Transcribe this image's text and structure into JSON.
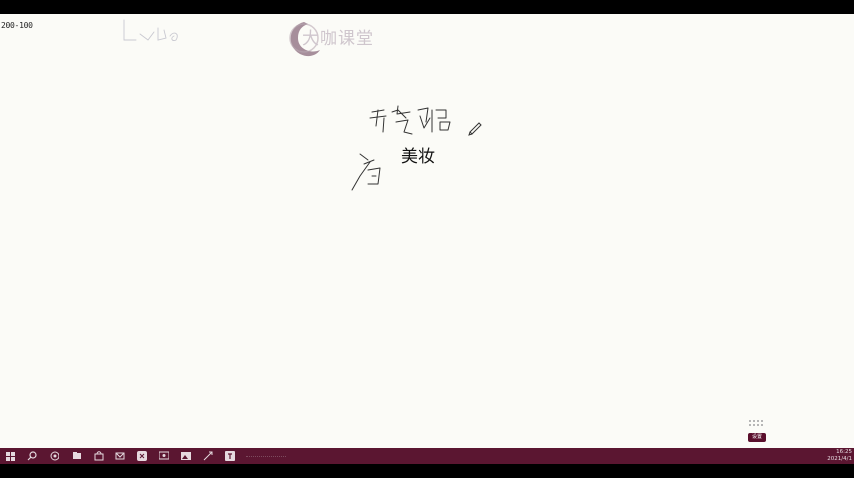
{
  "window": {
    "corner_text": "200-100"
  },
  "watermark": {
    "text": "大咖课堂",
    "color": "#cfc6cd"
  },
  "content": {
    "main_word": "美妆"
  },
  "bottom_right_button": {
    "label": "设置"
  },
  "taskbar": {
    "color": "#5b1631",
    "icons": [
      "windows-start-icon",
      "search-icon",
      "task-view-icon",
      "file-explorer-icon",
      "store-icon",
      "mail-icon",
      "app-icon",
      "screen-icon",
      "tools-icon",
      "text-app-icon"
    ],
    "clock_time": "16:25",
    "clock_date": "2021/4/1"
  }
}
